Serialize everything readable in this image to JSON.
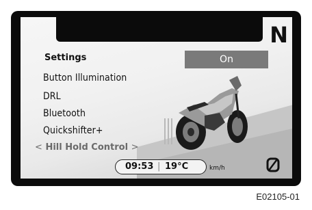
{
  "display": {
    "gear_indicator": "N",
    "settings_title": "Settings",
    "menu_items": [
      "Button Illumination",
      "DRL",
      "Bluetooth",
      "Quickshifter+"
    ],
    "selected_item": {
      "left_arrow": "<",
      "label": "Hill Hold Control",
      "right_arrow": ">"
    },
    "value_button": "On",
    "status_bar": {
      "time": "09:53",
      "separator": "|",
      "temperature": "19°C",
      "speed_unit": "km/h"
    },
    "icons": {
      "gear": "gear-letter",
      "bike": "motorcycle-image",
      "bottom_right": "slashed-zero-icon"
    }
  },
  "figure_caption": "E02105-01",
  "colors": {
    "bezel": "#0b0b0b",
    "screen": "#f1f1f1",
    "button": "#7a7a7a"
  }
}
